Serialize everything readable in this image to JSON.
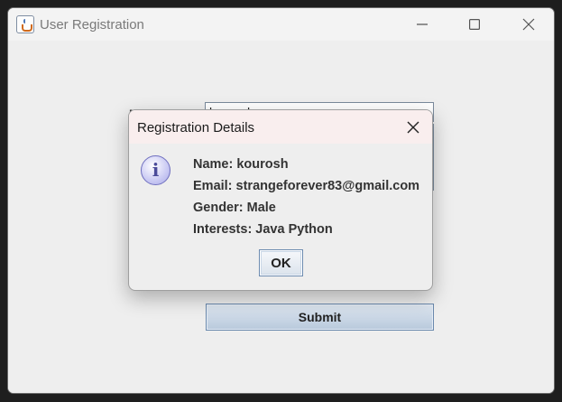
{
  "window": {
    "title": "User Registration"
  },
  "form": {
    "name_label": "Name:",
    "name_value": "kourosh",
    "submit_label": "Submit"
  },
  "dialog": {
    "title": "Registration Details",
    "lines": [
      "Name: kourosh",
      "Email: strangeforever83@gmail.com",
      "Gender: Male",
      "Interests: Java Python"
    ],
    "ok_label": "OK",
    "icon": "info-icon"
  },
  "icons": {
    "app": "java-app-icon",
    "minimize": "minimize-icon",
    "maximize": "maximize-icon",
    "close": "close-icon"
  }
}
